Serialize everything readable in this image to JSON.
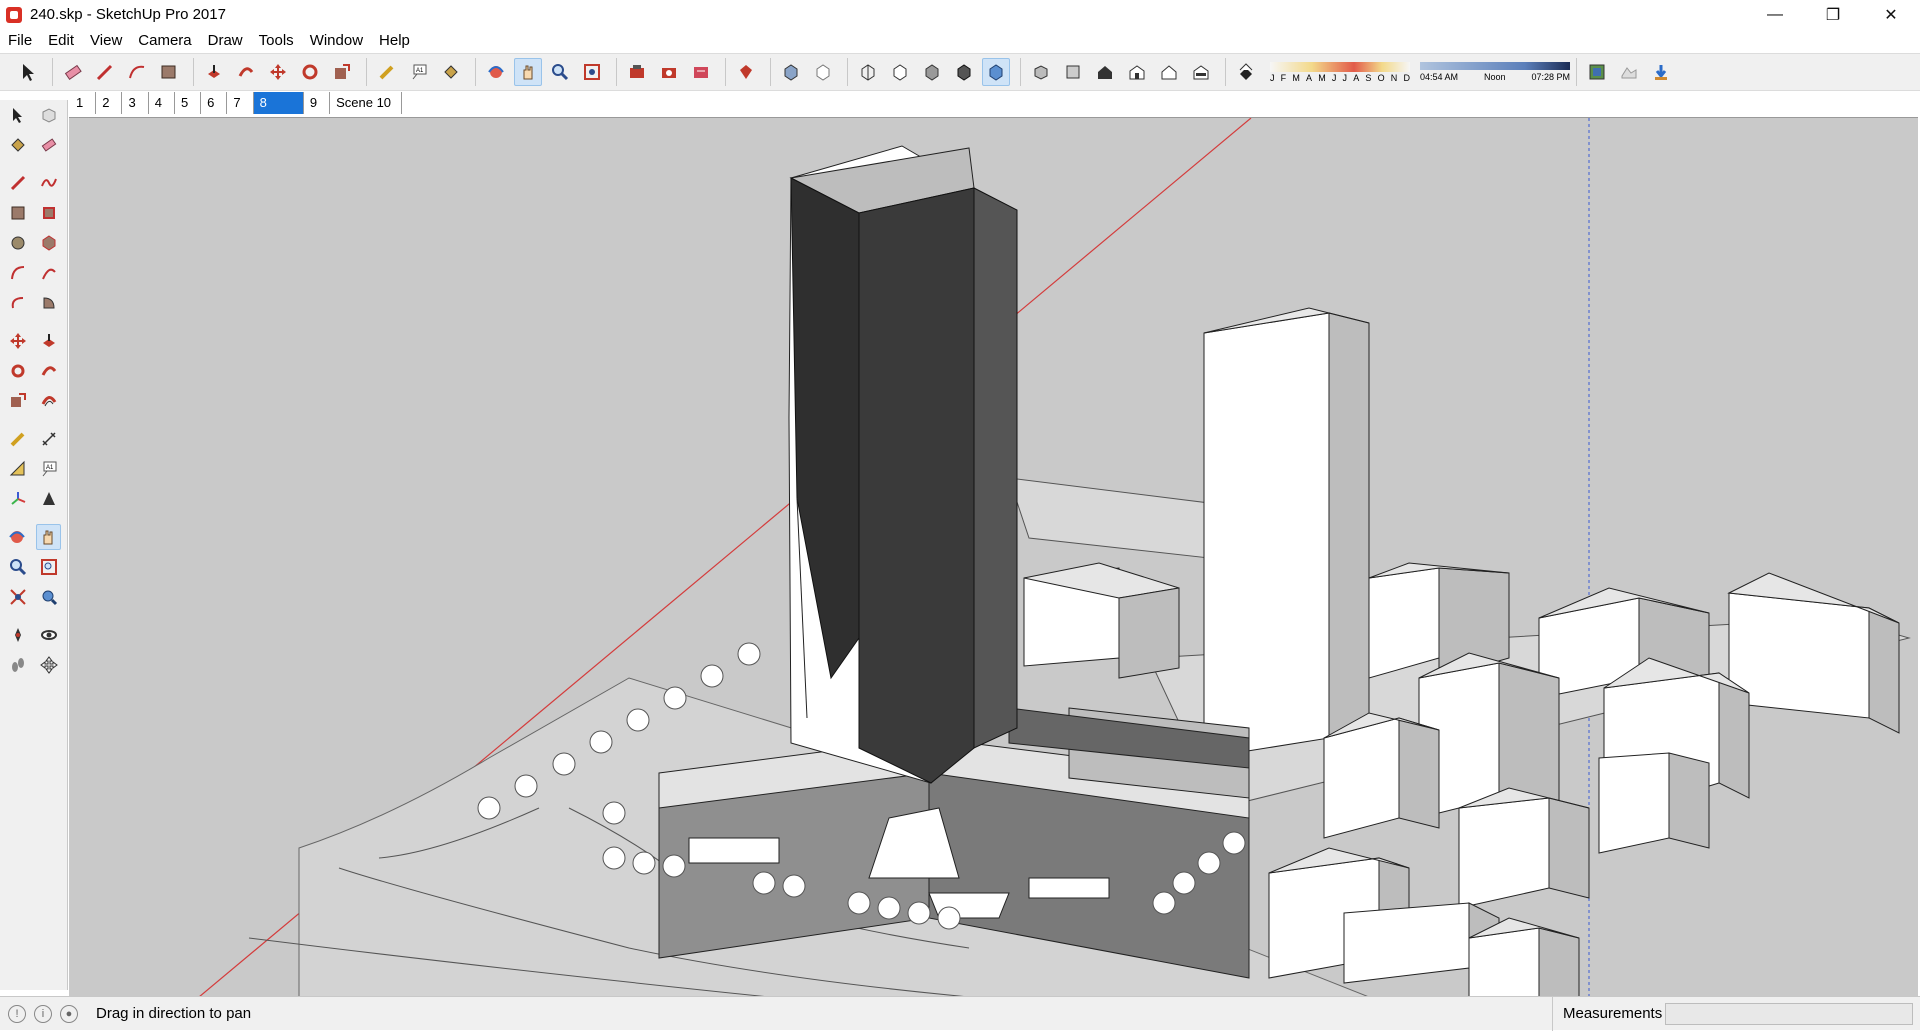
{
  "window": {
    "title": "240.skp - SketchUp Pro 2017",
    "icon": "sketchup-icon"
  },
  "window_controls": [
    "minimize-icon",
    "restore-icon",
    "close-icon"
  ],
  "menu": [
    "File",
    "Edit",
    "View",
    "Camera",
    "Draw",
    "Tools",
    "Window",
    "Help"
  ],
  "scenes": [
    "1",
    "2",
    "3",
    "4",
    "5",
    "6",
    "7",
    "8",
    "9",
    "Scene 10"
  ],
  "active_scene": "8",
  "shadow": {
    "months": [
      "J",
      "F",
      "M",
      "A",
      "M",
      "J",
      "J",
      "A",
      "S",
      "O",
      "N",
      "D"
    ],
    "time_start": "04:54 AM",
    "time_mid": "Noon",
    "time_end": "07:28 PM"
  },
  "status": {
    "message": "Drag in direction to pan",
    "measurements_label": "Measurements",
    "measurements_value": ""
  },
  "colors": {
    "selection": "#1a74d8",
    "axis_red": "#d43c3c",
    "axis_blue": "#3c5ad4",
    "ground": "#c9c9c9"
  }
}
